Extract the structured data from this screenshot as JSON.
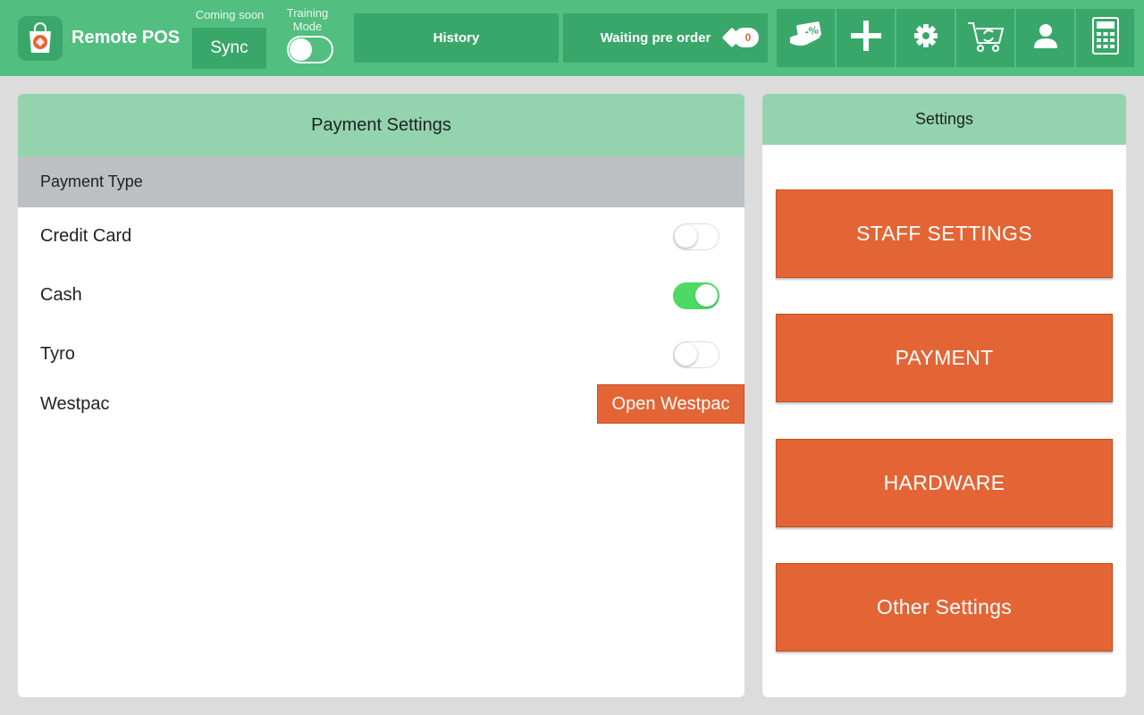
{
  "app": {
    "title": "Remote POS"
  },
  "topbar": {
    "coming_soon": "Coming soon",
    "sync_label": "Sync",
    "training_label": "Training Mode",
    "training_on": false,
    "history_label": "History",
    "waiting_label": "Waiting pre order",
    "waiting_count": "0",
    "icons": [
      "discount-icon",
      "plus-icon",
      "gear-icon",
      "cart-sync-icon",
      "user-icon",
      "calculator-icon"
    ]
  },
  "payment_settings": {
    "title": "Payment Settings",
    "section": "Payment Type",
    "rows": [
      {
        "label": "Credit Card",
        "enabled": false
      },
      {
        "label": "Cash",
        "enabled": true
      },
      {
        "label": "Tyro",
        "enabled": false
      }
    ],
    "westpac": {
      "label": "Westpac",
      "button": "Open Westpac"
    }
  },
  "settings_menu": {
    "title": "Settings",
    "items": [
      "STAFF SETTINGS",
      "PAYMENT",
      "HARDWARE",
      "Other Settings"
    ]
  },
  "colors": {
    "primary_green": "#52be80",
    "dark_green": "#3aa76a",
    "header_green": "#93d4af",
    "accent_orange": "#e36535",
    "switch_on": "#4cd964"
  }
}
